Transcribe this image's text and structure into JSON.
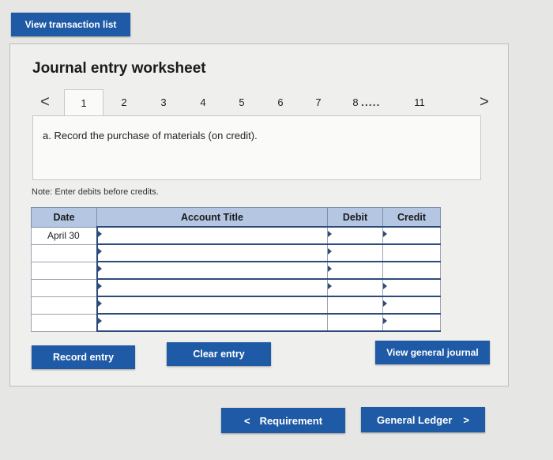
{
  "top": {
    "view_transaction_list": "View transaction list"
  },
  "worksheet": {
    "title": "Journal entry worksheet",
    "tabs": {
      "prev": "<",
      "next": ">",
      "items": [
        "1",
        "2",
        "3",
        "4",
        "5",
        "6",
        "7",
        "8"
      ],
      "dots": ".....",
      "last": "11",
      "active": "1"
    },
    "instruction": "a. Record the purchase of materials (on credit).",
    "note": "Note: Enter debits before credits."
  },
  "table": {
    "headers": {
      "date": "Date",
      "account": "Account Title",
      "debit": "Debit",
      "credit": "Credit"
    },
    "rows": [
      {
        "date": "April 30",
        "account": "",
        "debit": "",
        "credit": ""
      },
      {
        "date": "",
        "account": "",
        "debit": "",
        "credit": ""
      },
      {
        "date": "",
        "account": "",
        "debit": "",
        "credit": ""
      },
      {
        "date": "",
        "account": "",
        "debit": "",
        "credit": ""
      },
      {
        "date": "",
        "account": "",
        "debit": "",
        "credit": ""
      },
      {
        "date": "",
        "account": "",
        "debit": "",
        "credit": ""
      }
    ]
  },
  "actions": {
    "record_entry": "Record entry",
    "clear_entry": "Clear entry",
    "view_general_journal": "View general journal"
  },
  "footer_nav": {
    "requirement": "Requirement",
    "requirement_chevron": "<",
    "general_ledger": "General Ledger",
    "general_ledger_chevron": ">"
  },
  "colors": {
    "button_bg": "#1f5aa6",
    "header_bg": "#b4c6e2",
    "row_border": "#2d4b7a"
  }
}
